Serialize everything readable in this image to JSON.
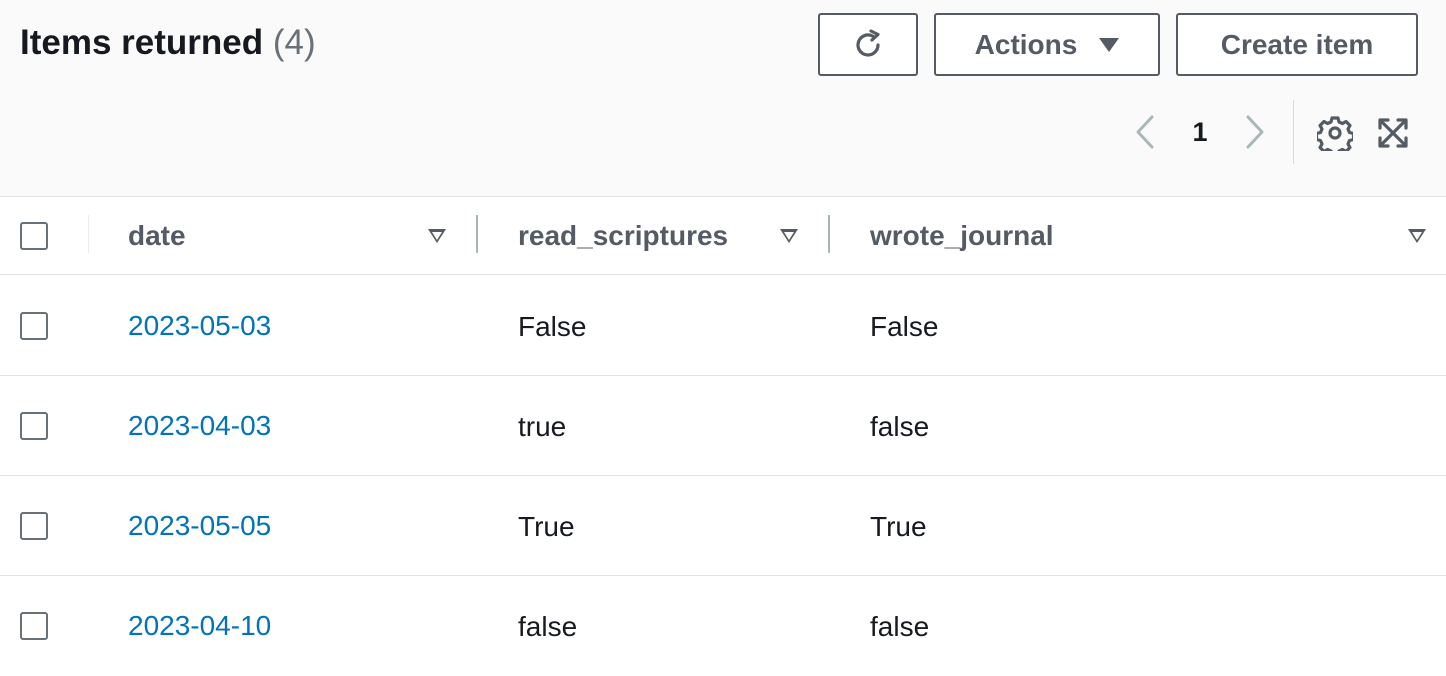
{
  "header": {
    "title": "Items returned",
    "count": "(4)",
    "refresh_icon": "refresh-icon",
    "actions_label": "Actions",
    "create_label": "Create item"
  },
  "pagination": {
    "current_page": "1",
    "prev_icon": "chevron-left-icon",
    "next_icon": "chevron-right-icon",
    "settings_icon": "gear-icon",
    "expand_icon": "expand-icon"
  },
  "table": {
    "columns": [
      {
        "label": "date"
      },
      {
        "label": "read_scriptures"
      },
      {
        "label": "wrote_journal"
      }
    ],
    "rows": [
      {
        "date": "2023-05-03",
        "read_scriptures": "False",
        "wrote_journal": "False"
      },
      {
        "date": "2023-04-03",
        "read_scriptures": "true",
        "wrote_journal": "false"
      },
      {
        "date": "2023-05-05",
        "read_scriptures": "True",
        "wrote_journal": "True"
      },
      {
        "date": "2023-04-10",
        "read_scriptures": "false",
        "wrote_journal": "false"
      }
    ]
  },
  "colors": {
    "link": "#0073bb",
    "text": "#16191f",
    "muted": "#545b64",
    "header_bg": "#fafafa",
    "border": "#e2e2e2"
  }
}
